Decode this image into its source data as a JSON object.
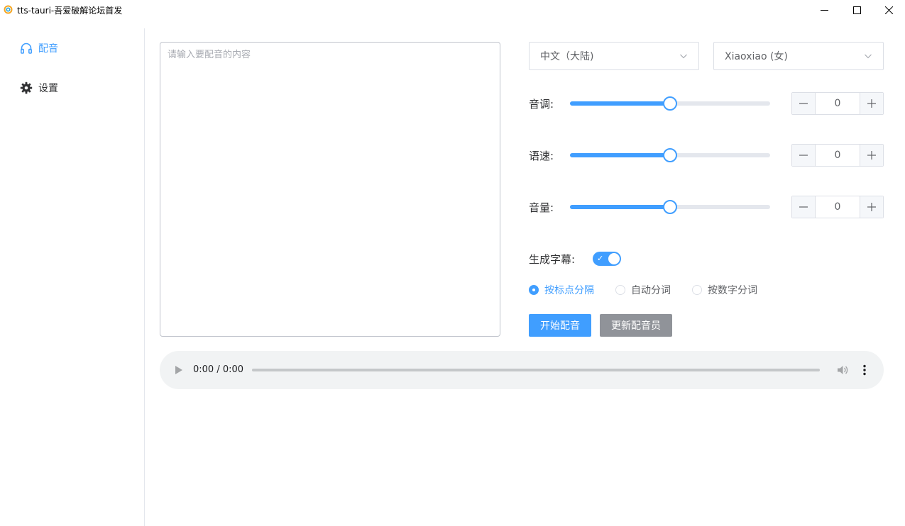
{
  "window": {
    "title": "tts-tauri-吾爱破解论坛首发",
    "controls": [
      "minimize",
      "maximize",
      "close"
    ]
  },
  "sidebar": {
    "items": [
      {
        "label": "配音",
        "icon": "headphones-icon",
        "active": true
      },
      {
        "label": "设置",
        "icon": "gear-icon",
        "active": false
      }
    ]
  },
  "editor": {
    "placeholder": "请输入要配音的内容",
    "value": ""
  },
  "selects": {
    "language": "中文（大陆)",
    "voice": "Xiaoxiao (女)"
  },
  "sliders": [
    {
      "label": "音调:",
      "level_percent": 50,
      "value": "0"
    },
    {
      "label": "语速:",
      "level_percent": 50,
      "value": "0"
    },
    {
      "label": "音量:",
      "level_percent": 50,
      "value": "0"
    }
  ],
  "subtitle": {
    "label": "生成字幕:",
    "enabled": true
  },
  "split_options": [
    {
      "label": "按标点分隔",
      "checked": true
    },
    {
      "label": "自动分词",
      "checked": false
    },
    {
      "label": "按数字分词",
      "checked": false
    }
  ],
  "actions": {
    "start_label": "开始配音",
    "update_label": "更新配音员"
  },
  "audio": {
    "time": "0:00 / 0:00",
    "progress_percent": 0
  },
  "colors": {
    "accent": "#409eff",
    "secondary_button": "#909399",
    "border": "#dcdfe6",
    "audio_bg": "#f1f3f4"
  }
}
